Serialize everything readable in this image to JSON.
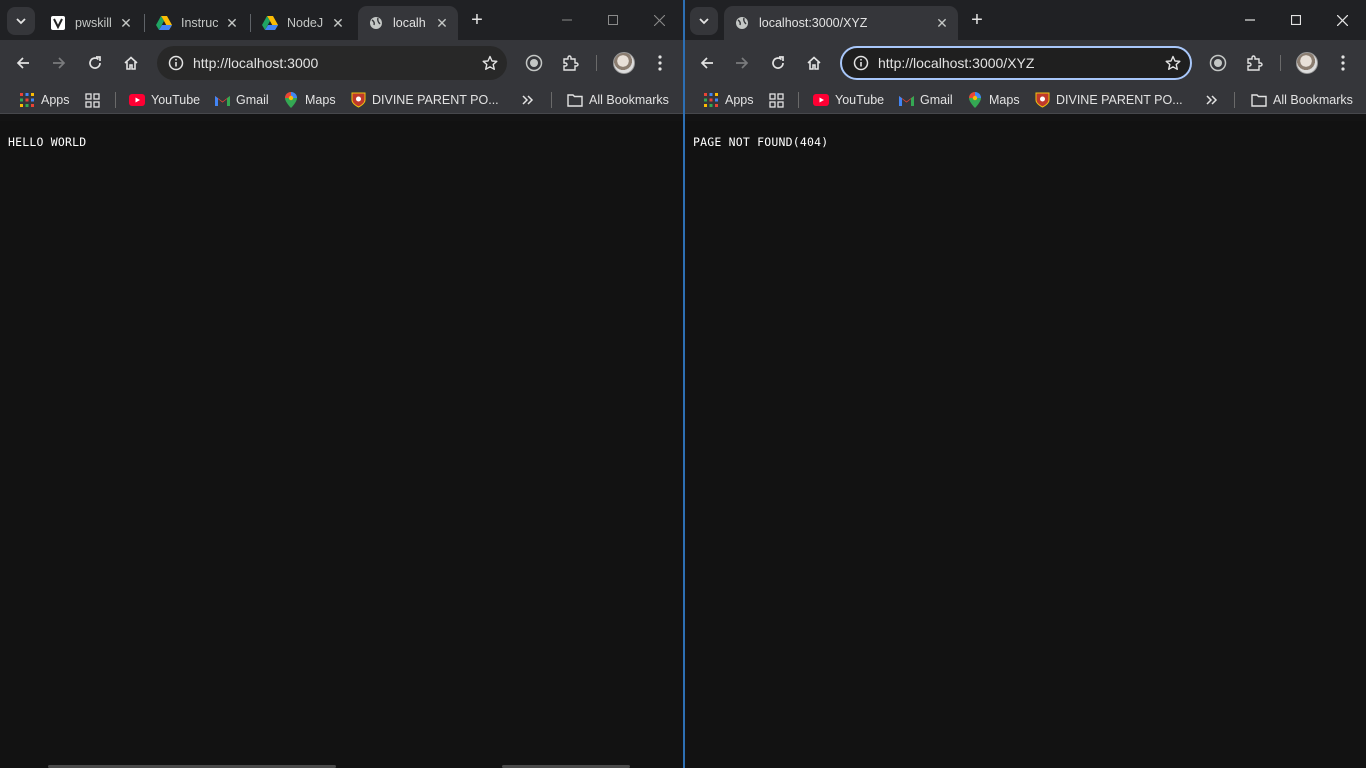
{
  "left_window": {
    "tabs": [
      {
        "title": "pwskills",
        "favicon": "pwskills-icon",
        "active": false
      },
      {
        "title": "Instruc",
        "favicon": "google-drive-icon",
        "active": false
      },
      {
        "title": "NodeJ",
        "favicon": "google-drive-icon",
        "active": false
      },
      {
        "title": "localh",
        "favicon": "globe-icon",
        "active": true
      }
    ],
    "url": "http://localhost:3000",
    "page_text": "HELLO WORLD"
  },
  "right_window": {
    "tabs": [
      {
        "title": "localhost:3000/XYZ",
        "favicon": "globe-icon",
        "active": true
      }
    ],
    "url": "http://localhost:3000/XYZ",
    "page_text": "PAGE NOT FOUND(404)"
  },
  "bookmarks": {
    "apps": "Apps",
    "youtube": "YouTube",
    "gmail": "Gmail",
    "maps": "Maps",
    "divine": "DIVINE PARENT PO...",
    "all": "All Bookmarks"
  },
  "colors": {
    "tabstrip": "#202124",
    "toolbar": "#35363a",
    "page_bg": "#121212",
    "focus_ring": "#a8c7fa"
  }
}
